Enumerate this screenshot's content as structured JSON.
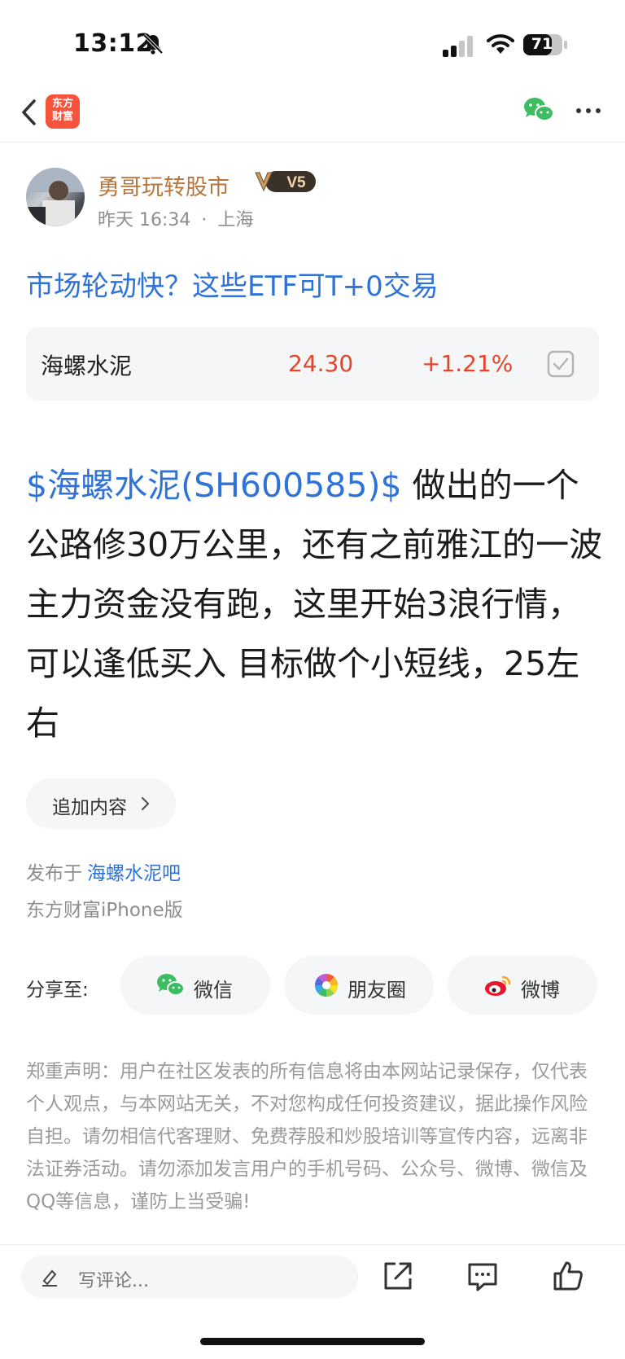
{
  "status_bar": {
    "time": "13:12",
    "battery": "71"
  },
  "nav": {
    "logo_line1": "东方",
    "logo_line2": "财富"
  },
  "author": {
    "name": "勇哥玩转股市",
    "badge": "V5",
    "time": "昨天 16:34",
    "location": "上海",
    "separator": "·"
  },
  "post": {
    "title": "市场轮动快？这些ETF可T+0交易",
    "stock_tag": "$海螺水泥(SH600585)$",
    "body_text": "  做出的一个公路修30万公里，还有之前雅江的一波主力资金没有跑，这里开始3浪行情，可以逢低买入 目标做个小短线，25左右"
  },
  "stock_card": {
    "name": "海螺水泥",
    "price": "24.30",
    "change": "+1.21%"
  },
  "append": {
    "label": "追加内容"
  },
  "publish": {
    "prefix": "发布于",
    "forum": "海螺水泥吧",
    "client": "东方财富iPhone版"
  },
  "share": {
    "label": "分享至:",
    "items": [
      {
        "label": "微信",
        "icon": "wechat-icon"
      },
      {
        "label": "朋友圈",
        "icon": "moments-icon"
      },
      {
        "label": "微博",
        "icon": "weibo-icon"
      }
    ]
  },
  "disclaimer": "郑重声明：用户在社区发表的所有信息将由本网站记录保存，仅代表个人观点，与本网站无关，不对您构成任何投资建议，据此操作风险自担。请勿相信代客理财、免费荐股和炒股培训等宣传内容，远离非法证券活动。请勿添加发言用户的手机号码、公众号、微博、微信及QQ等信息，谨防上当受骗!",
  "bottom_bar": {
    "comment_placeholder": "写评论..."
  },
  "colors": {
    "link_blue": "#2f73d8",
    "price_red": "#e1462b",
    "author_gold": "#b5773e"
  }
}
